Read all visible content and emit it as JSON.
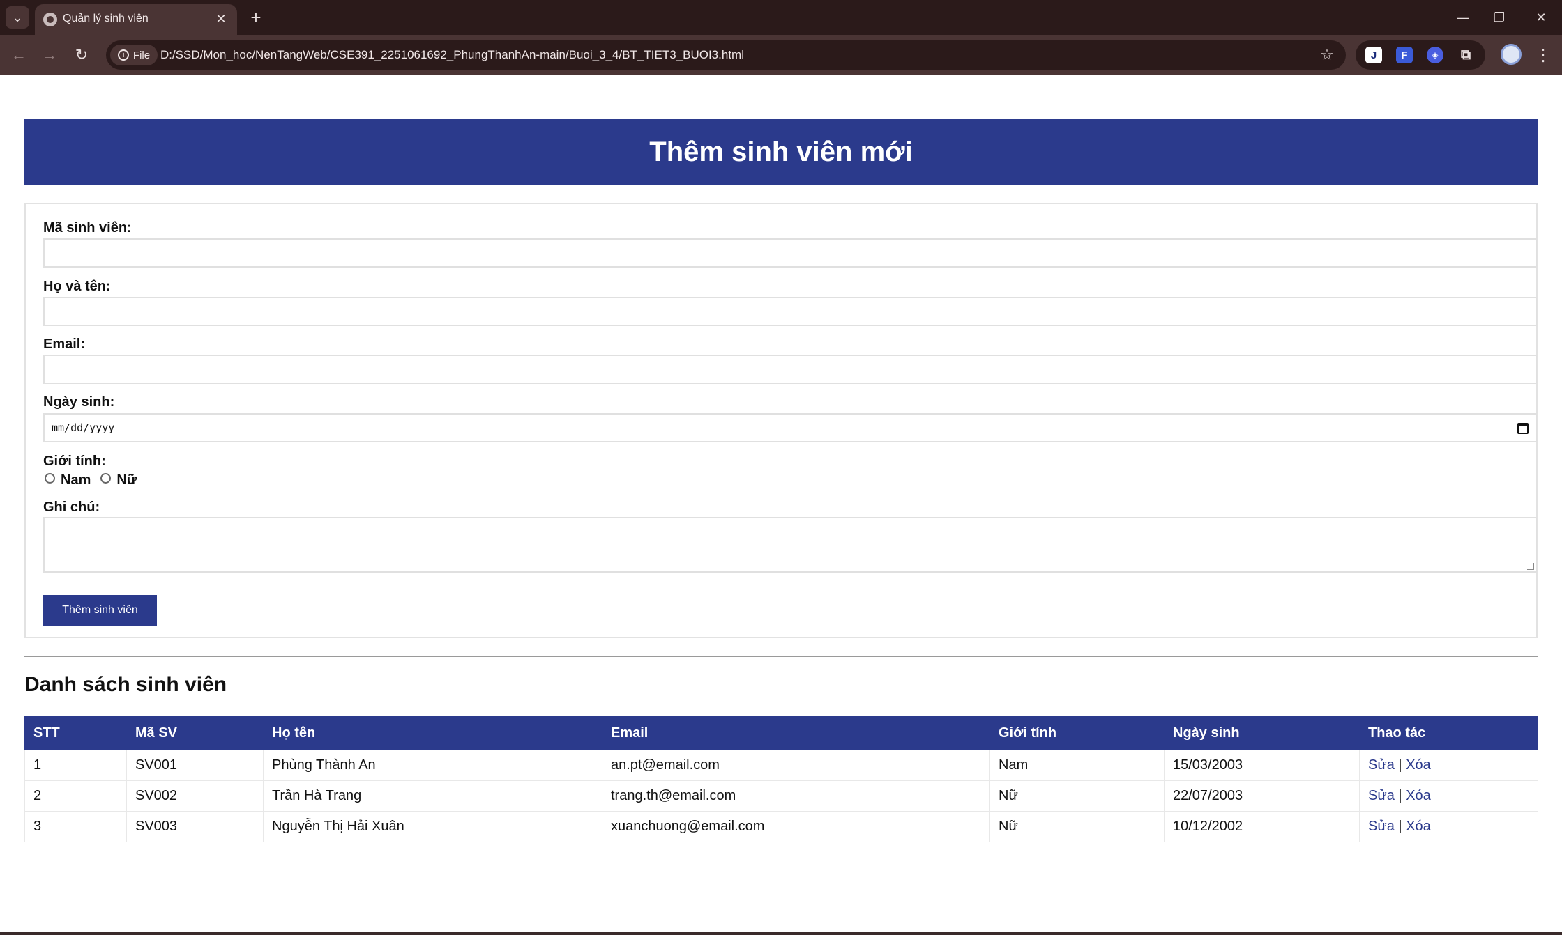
{
  "browser": {
    "tab_title": "Quản lý sinh viên",
    "site_chip": "File",
    "url": "D:/SSD/Mon_hoc/NenTangWeb/CSE391_2251061692_PhungThanhAn-main/Buoi_3_4/BT_TIET3_BUOI3.html",
    "icons": [
      "tab-search-icon",
      "favicon-icon",
      "close-icon",
      "plus-icon",
      "minimize-icon",
      "restore-icon",
      "close-window-icon",
      "back-icon",
      "forward-icon",
      "reload-icon",
      "info-icon",
      "star-icon",
      "extension-j-icon",
      "extension-f-icon",
      "extension-shield-icon",
      "puzzle-icon",
      "profile-icon",
      "more-icon"
    ]
  },
  "page": {
    "banner_title": "Thêm sinh viên mới",
    "form": {
      "student_id_label": "Mã sinh viên:",
      "fullname_label": "Họ và tên:",
      "email_label": "Email:",
      "dob_label": "Ngày sinh:",
      "dob_placeholder": "mm/dd/yyyy",
      "gender_label": "Giới tính:",
      "gender_options": [
        "Nam",
        "Nữ"
      ],
      "note_label": "Ghi chú:",
      "submit_label": "Thêm sinh viên"
    },
    "list_title": "Danh sách sinh viên",
    "table": {
      "headers": [
        "STT",
        "Mã SV",
        "Họ tên",
        "Email",
        "Giới tính",
        "Ngày sinh",
        "Thao tác"
      ],
      "rows": [
        {
          "stt": "1",
          "ma_sv": "SV001",
          "ho_ten": "Phùng Thành An",
          "email": "an.pt@email.com",
          "gioi_tinh": "Nam",
          "ngay_sinh": "15/03/2003"
        },
        {
          "stt": "2",
          "ma_sv": "SV002",
          "ho_ten": "Trần Hà Trang",
          "email": "trang.th@email.com",
          "gioi_tinh": "Nữ",
          "ngay_sinh": "22/07/2003"
        },
        {
          "stt": "3",
          "ma_sv": "SV003",
          "ho_ten": "Nguyễn Thị Hải Xuân",
          "email": "xuanchuong@email.com",
          "gioi_tinh": "Nữ",
          "ngay_sinh": "10/12/2002"
        }
      ],
      "edit_label": "Sửa",
      "separator": "|",
      "delete_label": "Xóa"
    }
  },
  "colors": {
    "primary": "#2b3a8c",
    "tab_bar": "#2b1a1a",
    "toolbar": "#4a3434"
  }
}
